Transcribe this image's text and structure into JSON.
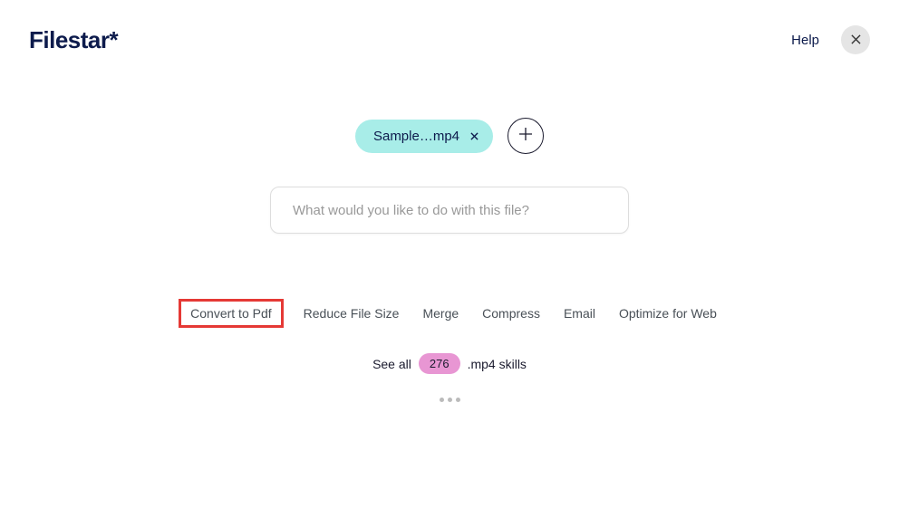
{
  "header": {
    "logo": "Filestar*",
    "help": "Help"
  },
  "file": {
    "name": "Sample…mp4"
  },
  "search": {
    "placeholder": "What would you like to do with this file?"
  },
  "skills": {
    "items": [
      "Convert to Pdf",
      "Reduce File Size",
      "Merge",
      "Compress",
      "Email",
      "Optimize for Web"
    ]
  },
  "see_all": {
    "prefix": "See all",
    "count": "276",
    "suffix": ".mp4 skills"
  }
}
